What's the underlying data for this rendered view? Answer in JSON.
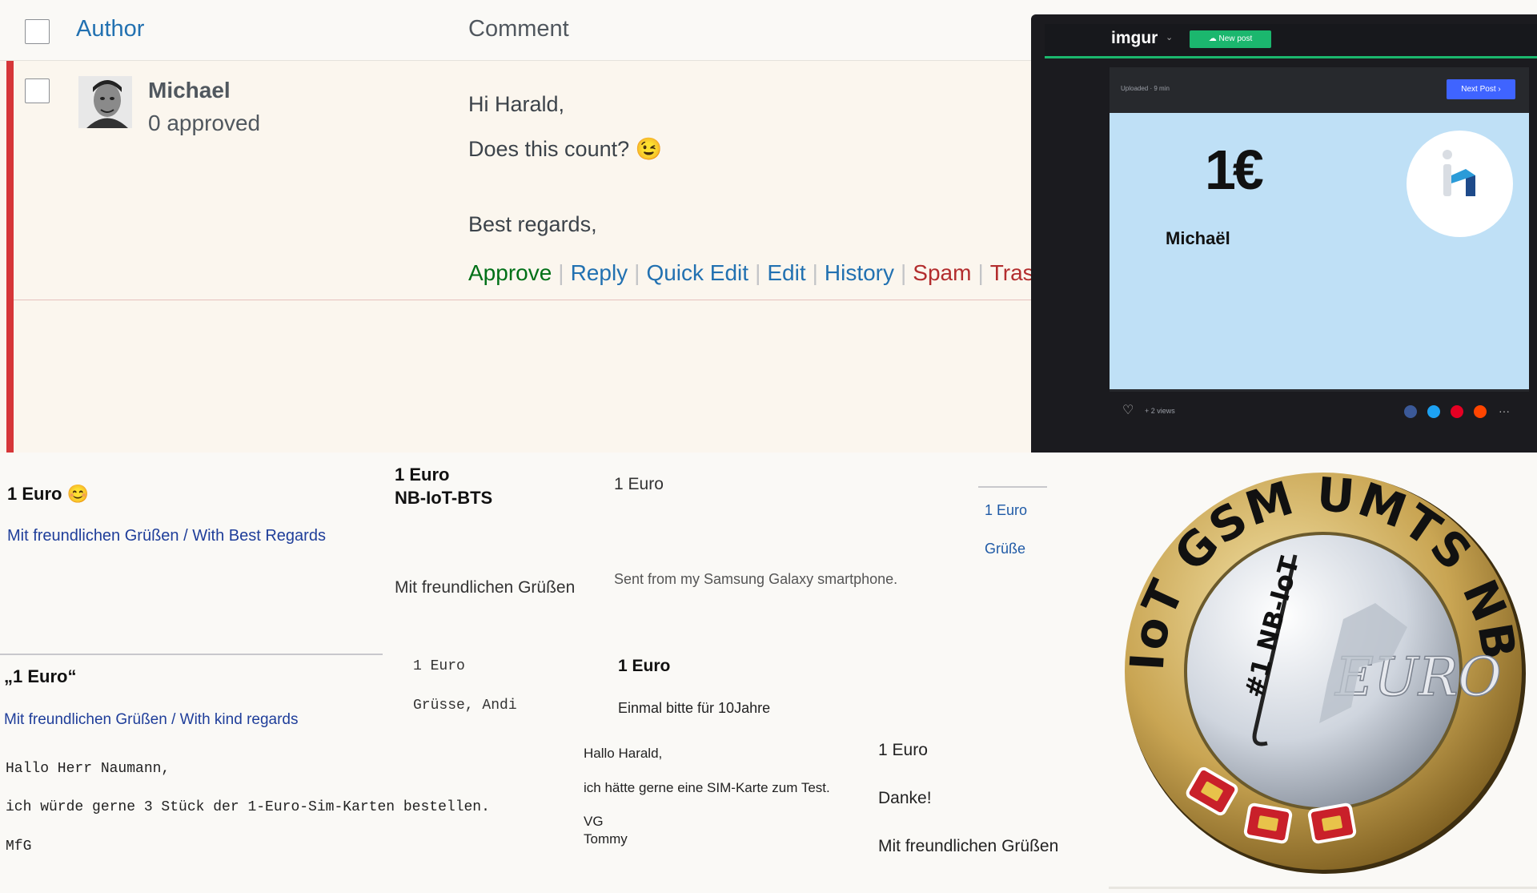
{
  "comment_table": {
    "header": {
      "author": "Author",
      "comment": "Comment"
    },
    "row": {
      "author_name": "Michael",
      "author_approved": "0 approved",
      "greeting": "Hi Harald,",
      "question": "Does this count? 😉",
      "closing": "Best regards,",
      "actions": [
        {
          "label": "Approve",
          "color": "#007017"
        },
        {
          "label": "Reply",
          "color": "#2271b1"
        },
        {
          "label": "Quick Edit",
          "color": "#2271b1"
        },
        {
          "label": "Edit",
          "color": "#2271b1"
        },
        {
          "label": "History",
          "color": "#2271b1"
        },
        {
          "label": "Spam",
          "color": "#b32d2e"
        },
        {
          "label": "Trash",
          "color": "#b32d2e"
        }
      ]
    }
  },
  "imgur": {
    "logo": "imgur",
    "new_post": "New post",
    "uploaded": "Uploaded · 9 min",
    "next_post": "Next Post",
    "card_price": "1€",
    "card_name": "Michaël",
    "views": "+ 2 views",
    "accent": "#1bb76e"
  },
  "collage": {
    "a_title": "1 Euro 😊",
    "a_sig": "Mit freundlichen Grüßen / With Best Regards",
    "b_title1": "1 Euro",
    "b_title2": "NB-IoT-BTS",
    "b_sig": "Mit freundlichen Grüßen",
    "c_title": "1 Euro",
    "c_sig": "Sent from my Samsung Galaxy smartphone.",
    "d_title": "1 Euro",
    "d_sig": "Grüße",
    "e_title": "„1 Euro“",
    "e_sig": "Mit freundlichen Grüßen / With kind regards",
    "f_title": "1 Euro",
    "f_sig": "Grüsse, Andi",
    "g_title": "1 Euro",
    "g_sig": "Einmal bitte für 10Jahre",
    "h_line1": "Hallo Herr Naumann,",
    "h_line2": "ich würde gerne 3 Stück der 1-Euro-Sim-Karten bestellen.",
    "h_line3": "MfG",
    "i_line1": "Hallo Harald,",
    "i_line2": "ich hätte gerne eine SIM-Karte zum Test.",
    "i_line3": "VG",
    "i_line4": "Tommy",
    "j_title": "1 Euro",
    "j_line": "Danke!",
    "j_sig": "Mit freundlichen Grüßen"
  },
  "coin": {
    "ring_text": "NB-IoT GSM UMTS NB-IoT",
    "inner_text": "#1 NB-IoT",
    "euro": "EURO"
  }
}
